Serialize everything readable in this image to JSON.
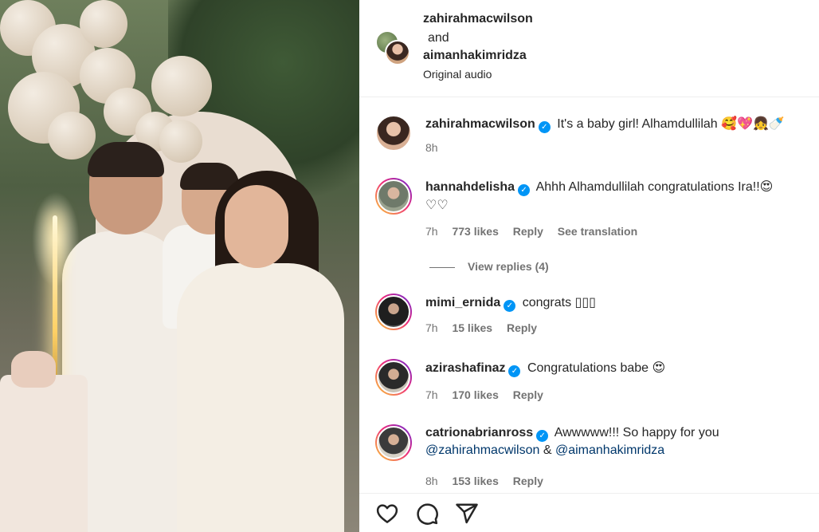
{
  "header": {
    "owner": "zahirahmacwilson",
    "and_label": "and",
    "collaborator": "aimanhakimridza",
    "audio": "Original audio"
  },
  "comments": [
    {
      "username": "zahirahmacwilson",
      "verified": true,
      "text": "It's a baby girl! Alhamdullilah",
      "emoji": "🥰💖👧🍼",
      "time": "8h"
    },
    {
      "username": "hannahdelisha",
      "verified": true,
      "text": "Ahhh Alhamdullilah congratulations Ira!!",
      "emoji": "😍",
      "emoji2": "♡♡",
      "time": "7h",
      "likes": "773 likes",
      "reply": "Reply",
      "translation": "See translation",
      "view_replies": "View replies (4)"
    },
    {
      "username": "mimi_ernida",
      "verified": true,
      "text": "congrats",
      "emoji": "▯▯▯",
      "time": "7h",
      "likes": "15 likes",
      "reply": "Reply"
    },
    {
      "username": "azirashafinaz",
      "verified": true,
      "text": "Congratulations babe",
      "emoji": "😍",
      "time": "7h",
      "likes": "170 likes",
      "reply": "Reply"
    },
    {
      "username": "catrionabrianross",
      "verified": true,
      "text": "Awwwww!!! So happy for you",
      "mention1": "@zahirahmacwilson",
      "amp": "&",
      "mention2": "@aimanhakimridza",
      "time": "8h",
      "likes": "153 likes",
      "reply": "Reply"
    }
  ],
  "actions": {
    "like_icon": "heart-icon",
    "comment_icon": "comment-icon",
    "share_icon": "paper-plane-icon"
  },
  "colors": {
    "verified": "#0095f6",
    "secondary_text": "#737373",
    "mention": "#00376b"
  }
}
